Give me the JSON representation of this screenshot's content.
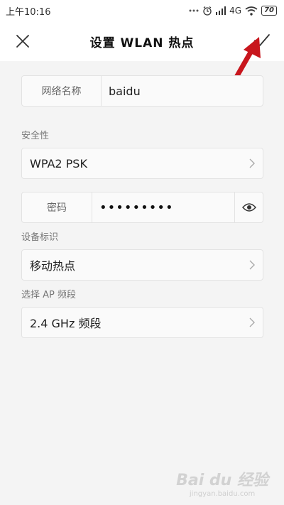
{
  "status_bar": {
    "time": "上午10:16",
    "network": "4G",
    "battery": "70"
  },
  "header": {
    "title": "设置 WLAN 热点"
  },
  "fields": {
    "network_name": {
      "label": "网络名称",
      "value": "baidu"
    },
    "security": {
      "section_label": "安全性",
      "value": "WPA2 PSK"
    },
    "password": {
      "label": "密码",
      "value": "•••••••••"
    },
    "device_id": {
      "section_label": "设备标识",
      "value": "移动热点"
    },
    "ap_band": {
      "section_label": "选择 AP 频段",
      "value": "2.4 GHz 频段"
    }
  },
  "watermark": {
    "logo": "Bai du 经验",
    "sub": "jingyan.baidu.com"
  },
  "colors": {
    "annotation_arrow": "#c8161d",
    "background": "#f4f4f4",
    "card": "#fafafa"
  }
}
